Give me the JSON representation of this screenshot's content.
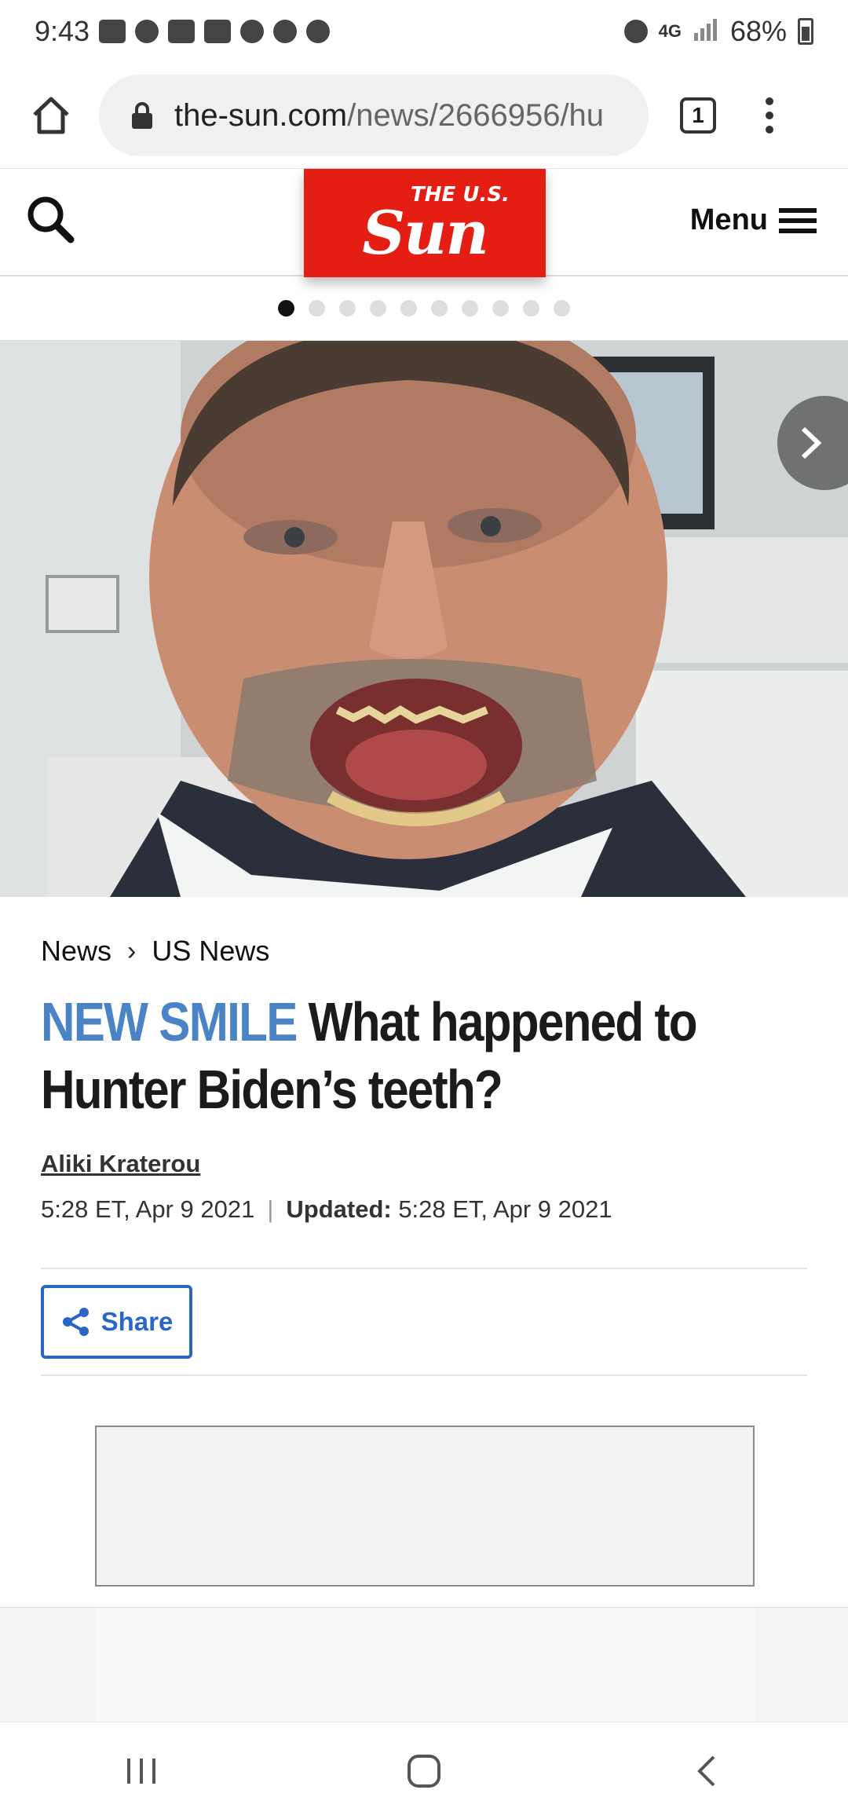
{
  "status_bar": {
    "time": "9:43",
    "network": "4G",
    "battery": "68%"
  },
  "browser": {
    "url_domain": "the-sun.com",
    "url_path": "/news/2666956/hu",
    "tab_count": "1"
  },
  "site_header": {
    "logo_small": "THE U.S.",
    "logo_big": "Sun",
    "menu_label": "Menu"
  },
  "carousel": {
    "total_slides": 10,
    "active_slide": 1
  },
  "article": {
    "breadcrumb": [
      "News",
      "US News"
    ],
    "kicker": "NEW SMILE",
    "title": "What happened to Hunter Biden’s teeth?",
    "author": "Aliki Kraterou",
    "published": "5:28 ET, Apr 9 2021",
    "updated_label": "Updated",
    "updated": "5:28 ET, Apr 9 2021",
    "share_label": "Share"
  },
  "colors": {
    "brand_red": "#e41e13",
    "kicker_blue": "#4a84c6",
    "share_blue": "#2a66c6"
  }
}
